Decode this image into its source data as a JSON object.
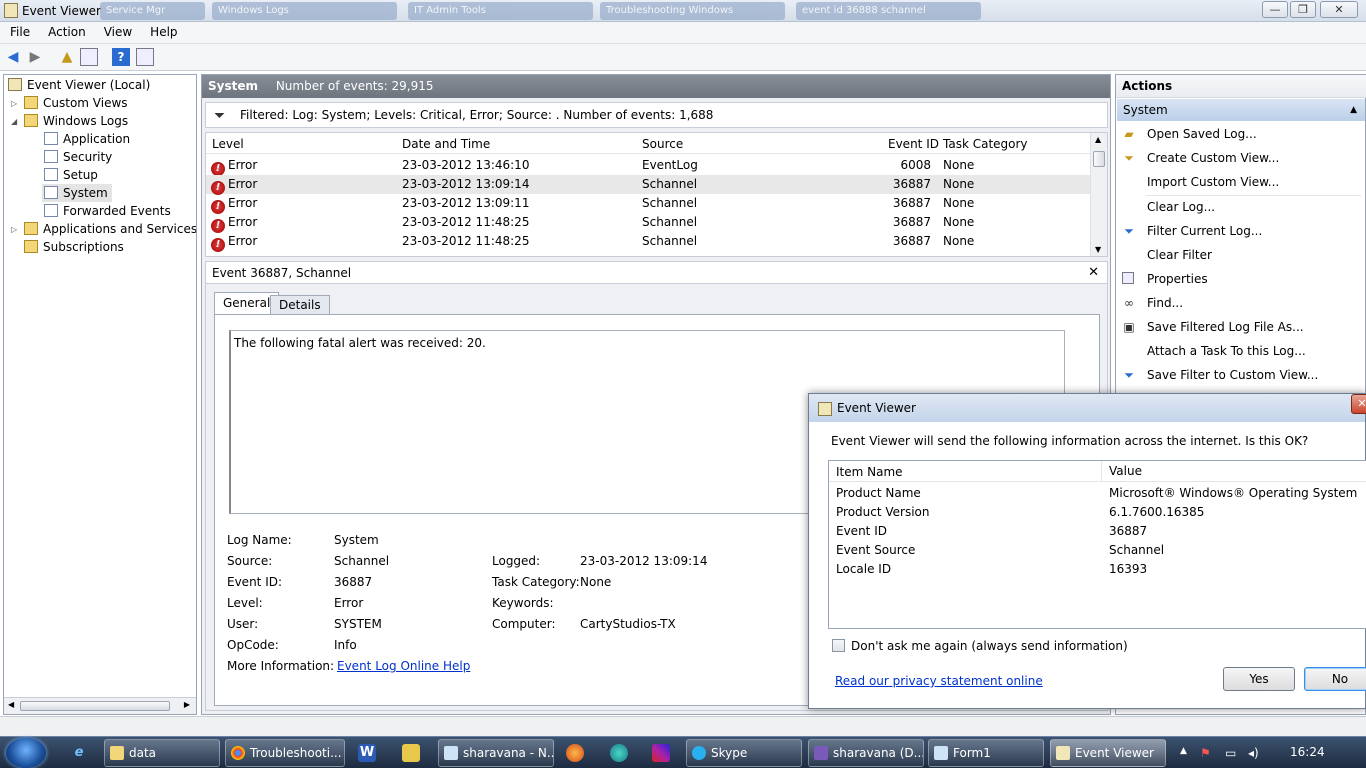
{
  "window": {
    "title": "Event Viewer",
    "min": "—",
    "max": "❐",
    "close": "✕"
  },
  "bgtabs": [
    "Service Mgr",
    "Windows Logs",
    "IT Admin Tools",
    "Troubleshooting Windows",
    "event id 36888 schannel"
  ],
  "menu": [
    "File",
    "Action",
    "View",
    "Help"
  ],
  "tree": {
    "root": "Event Viewer (Local)",
    "custom_views": "Custom Views",
    "windows_logs": "Windows Logs",
    "application": "Application",
    "security": "Security",
    "setup": "Setup",
    "system": "System",
    "forwarded": "Forwarded Events",
    "apps_services": "Applications and Services Logs",
    "subscriptions": "Subscriptions"
  },
  "main": {
    "header_title": "System",
    "header_count": "Number of events: 29,915",
    "filter_text": "Filtered: Log: System; Levels: Critical, Error; Source: . Number of events: 1,688",
    "columns": [
      "Level",
      "Date and Time",
      "Source",
      "Event ID",
      "Task Category"
    ],
    "rows": [
      {
        "level": "Error",
        "date": "23-03-2012 13:46:10",
        "source": "EventLog",
        "id": "6008",
        "task": "None"
      },
      {
        "level": "Error",
        "date": "23-03-2012 13:09:14",
        "source": "Schannel",
        "id": "36887",
        "task": "None"
      },
      {
        "level": "Error",
        "date": "23-03-2012 13:09:11",
        "source": "Schannel",
        "id": "36887",
        "task": "None"
      },
      {
        "level": "Error",
        "date": "23-03-2012 11:48:25",
        "source": "Schannel",
        "id": "36887",
        "task": "None"
      },
      {
        "level": "Error",
        "date": "23-03-2012 11:48:25",
        "source": "Schannel",
        "id": "36887",
        "task": "None"
      }
    ]
  },
  "detail": {
    "title": "Event 36887, Schannel",
    "tab_general": "General",
    "tab_details": "Details",
    "description": "The following fatal alert was received: 20.",
    "log_name_label": "Log Name:",
    "log_name": "System",
    "source_label": "Source:",
    "source": "Schannel",
    "logged_label": "Logged:",
    "logged": "23-03-2012 13:09:14",
    "event_id_label": "Event ID:",
    "event_id": "36887",
    "task_cat_label": "Task Category:",
    "task_cat": "None",
    "level_label": "Level:",
    "level": "Error",
    "keywords_label": "Keywords:",
    "user_label": "User:",
    "user": "SYSTEM",
    "computer_label": "Computer:",
    "computer": "CartyStudios-TX",
    "opcode_label": "OpCode:",
    "opcode": "Info",
    "more_info_label": "More Information:",
    "more_info_link": "Event Log Online Help"
  },
  "actions": {
    "title": "Actions",
    "section": "System",
    "items": [
      "Open Saved Log...",
      "Create Custom View...",
      "Import Custom View...",
      "Clear Log...",
      "Filter Current Log...",
      "Clear Filter",
      "Properties",
      "Find...",
      "Save Filtered Log File As...",
      "Attach a Task To this Log...",
      "Save Filter to Custom View..."
    ]
  },
  "dialog": {
    "title": "Event Viewer",
    "message": "Event Viewer will send the following information across the internet. Is this OK?",
    "col_item": "Item Name",
    "col_value": "Value",
    "rows": [
      {
        "name": "Product Name",
        "value": "Microsoft® Windows® Operating System"
      },
      {
        "name": "Product Version",
        "value": "6.1.7600.16385"
      },
      {
        "name": "Event ID",
        "value": "36887"
      },
      {
        "name": "Event Source",
        "value": "Schannel"
      },
      {
        "name": "Locale ID",
        "value": "16393"
      }
    ],
    "checkbox_label": "Don't ask me again (always send information)",
    "privacy_link": "Read our privacy statement online",
    "yes": "Yes",
    "no": "No"
  },
  "taskbar": {
    "tasks": [
      "data",
      "Troubleshooti...",
      "sharavana - N...",
      "Skype",
      "sharavana (D...",
      "Form1",
      "Event Viewer"
    ],
    "clock": "16:24"
  },
  "colors": {
    "error": "#c00000",
    "link": "#0033cc",
    "selected": "#e8e8e8"
  }
}
